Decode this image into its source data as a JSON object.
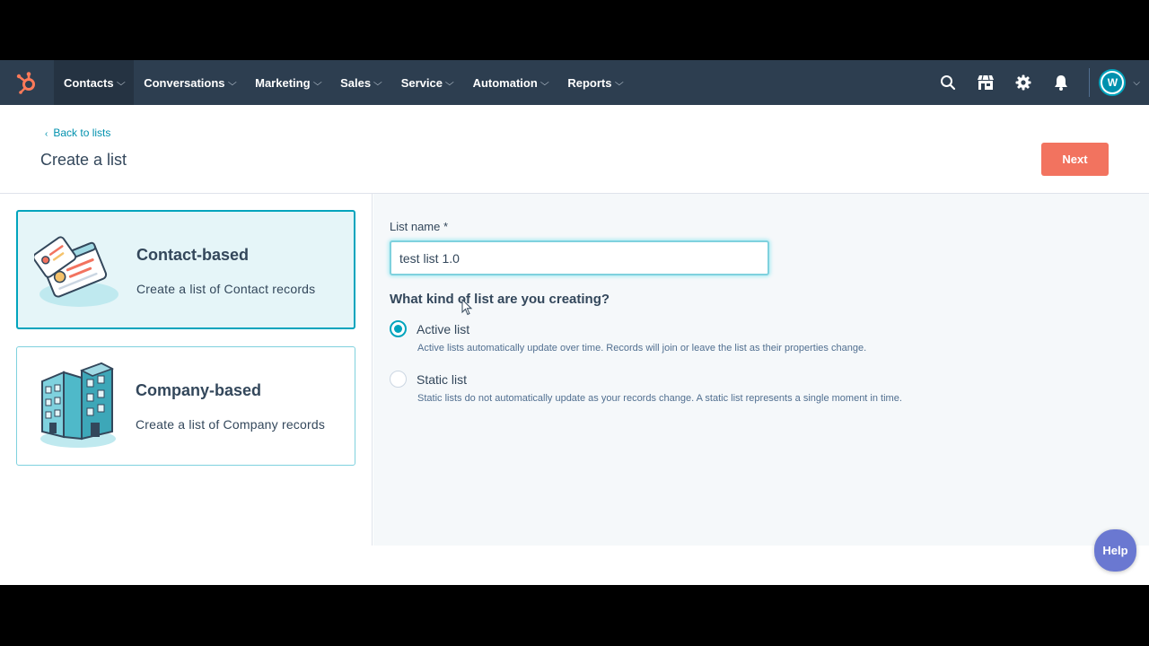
{
  "nav": {
    "items": [
      {
        "label": "Contacts",
        "active": true
      },
      {
        "label": "Conversations",
        "active": false
      },
      {
        "label": "Marketing",
        "active": false
      },
      {
        "label": "Sales",
        "active": false
      },
      {
        "label": "Service",
        "active": false
      },
      {
        "label": "Automation",
        "active": false
      },
      {
        "label": "Reports",
        "active": false
      }
    ],
    "right_icons": [
      "search-icon",
      "marketplace-icon",
      "settings-icon",
      "notifications-icon"
    ],
    "avatar_initial": "W"
  },
  "header": {
    "back_label": "Back to lists",
    "title": "Create a list",
    "next_label": "Next"
  },
  "cards": [
    {
      "title": "Contact-based",
      "description": "Create a list of Contact records",
      "selected": true
    },
    {
      "title": "Company-based",
      "description": "Create a list of Company records",
      "selected": false
    }
  ],
  "form": {
    "name_label": "List name *",
    "name_value": "test list 1.0",
    "question": "What kind of list are you creating?",
    "options": [
      {
        "label": "Active list",
        "help": "Active lists automatically update over time. Records will join or leave the list as their properties change.",
        "checked": true
      },
      {
        "label": "Static list",
        "help": "Static lists do not automatically update as your records change. A static list represents a single moment in time.",
        "checked": false
      }
    ]
  },
  "help_label": "Help",
  "colors": {
    "nav_bg": "#2d3e50",
    "accent_teal": "#00a4bd",
    "primary_button": "#f2735f",
    "help_button": "#6a78d1"
  }
}
